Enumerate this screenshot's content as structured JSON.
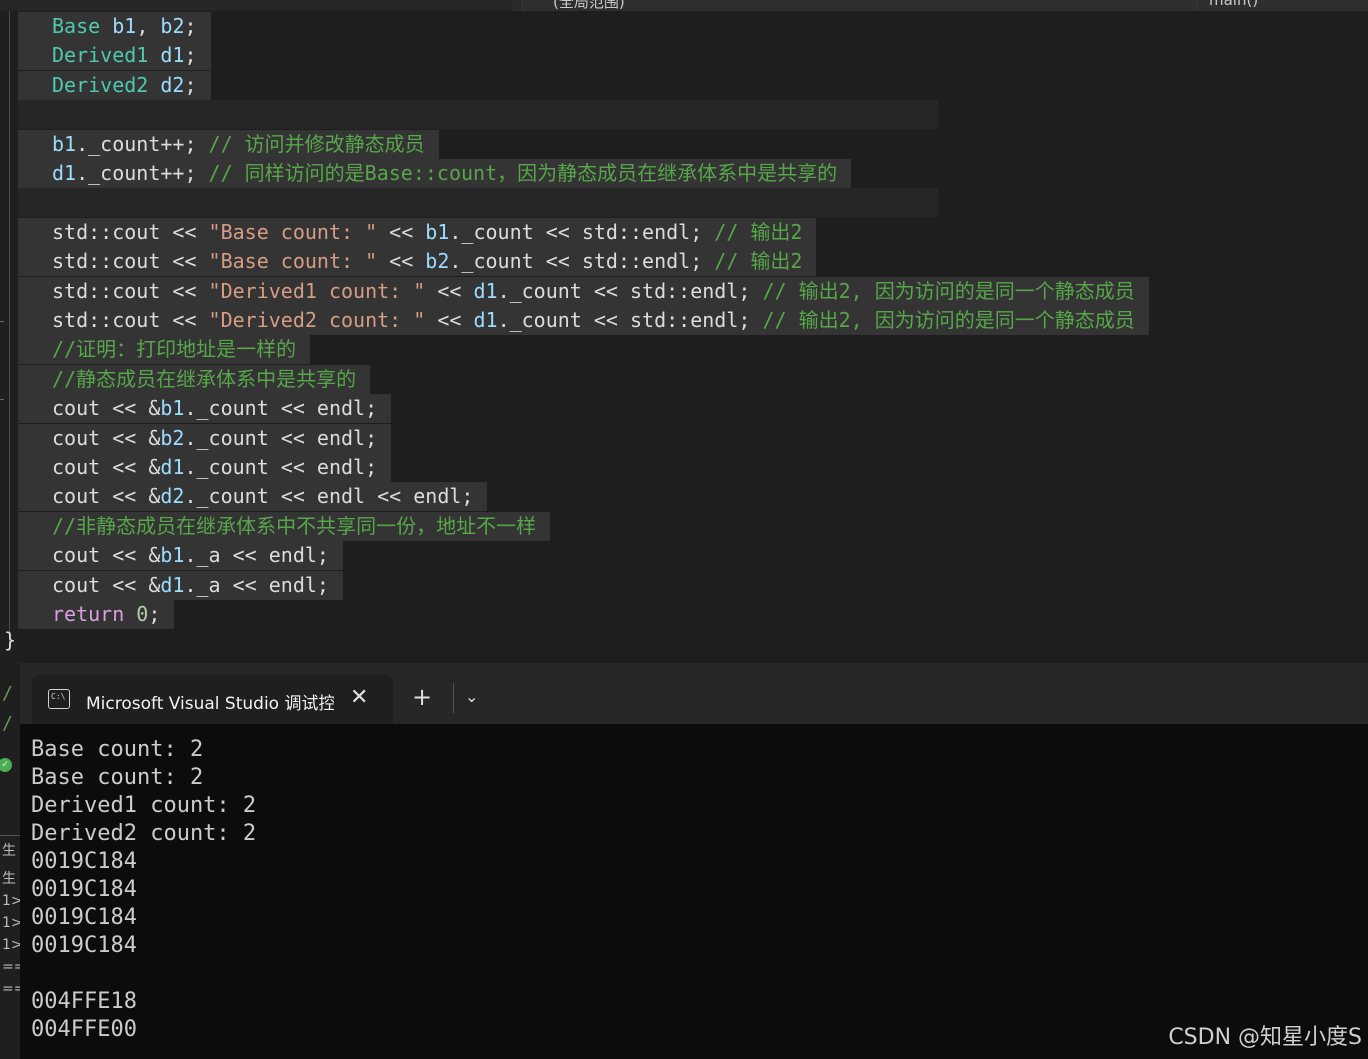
{
  "top_bar": {
    "scope_label": "(全局范围)",
    "function_label": "main()"
  },
  "code": {
    "closing_brace": "}",
    "lines": [
      [
        [
          "ty",
          "Base "
        ],
        [
          "v",
          "b1"
        ],
        [
          "p",
          ", "
        ],
        [
          "v",
          "b2"
        ],
        [
          "p",
          ";"
        ]
      ],
      [
        [
          "ty",
          "Derived1 "
        ],
        [
          "v",
          "d1"
        ],
        [
          "p",
          ";"
        ]
      ],
      [
        [
          "ty",
          "Derived2 "
        ],
        [
          "v",
          "d2"
        ],
        [
          "p",
          ";"
        ]
      ],
      [],
      [
        [
          "v",
          "b1"
        ],
        [
          "p",
          "._count++; "
        ],
        [
          "c",
          "// 访问并修改静态成员"
        ]
      ],
      [
        [
          "v",
          "d1"
        ],
        [
          "p",
          "._count++; "
        ],
        [
          "c",
          "// 同样访问的是Base::count，因为静态成员在继承体系中是共享的"
        ]
      ],
      [],
      [
        [
          "p",
          "std::cout << "
        ],
        [
          "s",
          "\"Base count: \""
        ],
        [
          "p",
          " << "
        ],
        [
          "v",
          "b1"
        ],
        [
          "p",
          "._count << std::endl; "
        ],
        [
          "c",
          "// 输出2"
        ]
      ],
      [
        [
          "p",
          "std::cout << "
        ],
        [
          "s",
          "\"Base count: \""
        ],
        [
          "p",
          " << "
        ],
        [
          "v",
          "b2"
        ],
        [
          "p",
          "._count << std::endl; "
        ],
        [
          "c",
          "// 输出2"
        ]
      ],
      [
        [
          "p",
          "std::cout << "
        ],
        [
          "s",
          "\"Derived1 count: \""
        ],
        [
          "p",
          " << "
        ],
        [
          "v",
          "d1"
        ],
        [
          "p",
          "._count << std::endl; "
        ],
        [
          "c",
          "// 输出2, 因为访问的是同一个静态成员"
        ]
      ],
      [
        [
          "p",
          "std::cout << "
        ],
        [
          "s",
          "\"Derived2 count: \""
        ],
        [
          "p",
          " << "
        ],
        [
          "v",
          "d1"
        ],
        [
          "p",
          "._count << std::endl; "
        ],
        [
          "c",
          "// 输出2, 因为访问的是同一个静态成员"
        ]
      ],
      [
        [
          "c",
          "//证明：打印地址是一样的"
        ]
      ],
      [
        [
          "c",
          "//静态成员在继承体系中是共享的"
        ]
      ],
      [
        [
          "p",
          "cout << &"
        ],
        [
          "v",
          "b1"
        ],
        [
          "p",
          "._count << endl;"
        ]
      ],
      [
        [
          "p",
          "cout << &"
        ],
        [
          "v",
          "b2"
        ],
        [
          "p",
          "._count << endl;"
        ]
      ],
      [
        [
          "p",
          "cout << &"
        ],
        [
          "v",
          "d1"
        ],
        [
          "p",
          "._count << endl;"
        ]
      ],
      [
        [
          "p",
          "cout << &"
        ],
        [
          "v",
          "d2"
        ],
        [
          "p",
          "._count << endl << endl;"
        ]
      ],
      [
        [
          "c",
          "//非静态成员在继承体系中不共享同一份，地址不一样"
        ]
      ],
      [
        [
          "p",
          "cout << &"
        ],
        [
          "v",
          "b1"
        ],
        [
          "p",
          "._a << endl;"
        ]
      ],
      [
        [
          "p",
          "cout << &"
        ],
        [
          "v",
          "d1"
        ],
        [
          "p",
          "._a << endl;"
        ]
      ],
      [
        [
          "kw2",
          "return "
        ],
        [
          "n",
          "0"
        ],
        [
          "p",
          ";"
        ]
      ]
    ]
  },
  "side_panel": {
    "frag1": "/",
    "frag2": "/",
    "rows": [
      "生",
      "生",
      "1>",
      "1>",
      "1>",
      "==",
      "=="
    ]
  },
  "terminal": {
    "tab_title": "Microsoft Visual Studio 调试控制台",
    "close_glyph": "✕",
    "new_tab_glyph": "+",
    "dropdown_glyph": "⌄",
    "output": [
      "Base count: 2",
      "Base count: 2",
      "Derived1 count: 2",
      "Derived2 count: 2",
      "0019C184",
      "0019C184",
      "0019C184",
      "0019C184",
      "",
      "004FFE18",
      "004FFE00"
    ]
  },
  "watermark": "CSDN @知星小度S"
}
